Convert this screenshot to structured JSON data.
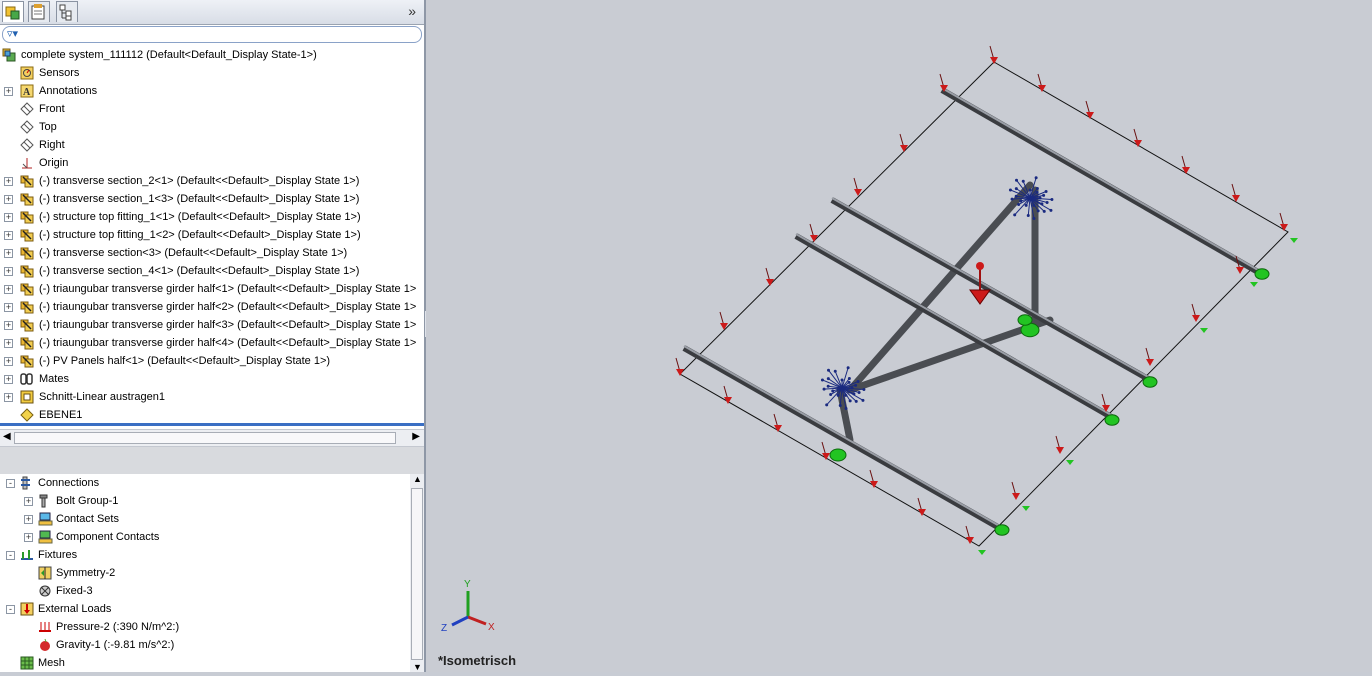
{
  "feature_tree": {
    "items": [
      {
        "label": "complete system_111112  (Default<Default_Display State-1>)",
        "icon": "assembly-icon",
        "expander": ""
      },
      {
        "label": "Sensors",
        "icon": "sensors-icon",
        "expander": ""
      },
      {
        "label": "Annotations",
        "icon": "annotations-icon",
        "expander": "+"
      },
      {
        "label": "Front",
        "icon": "plane-icon",
        "expander": ""
      },
      {
        "label": "Top",
        "icon": "plane-icon",
        "expander": ""
      },
      {
        "label": "Right",
        "icon": "plane-icon",
        "expander": ""
      },
      {
        "label": "Origin",
        "icon": "origin-icon",
        "expander": ""
      },
      {
        "label": "(-) transverse section_2<1> (Default<<Default>_Display State 1>)",
        "icon": "subassembly-icon",
        "expander": "+"
      },
      {
        "label": "(-) transverse section_1<3> (Default<<Default>_Display State 1>)",
        "icon": "subassembly-icon",
        "expander": "+"
      },
      {
        "label": "(-) structure top fitting_1<1> (Default<<Default>_Display State 1>)",
        "icon": "subassembly-icon",
        "expander": "+"
      },
      {
        "label": "(-) structure top fitting_1<2> (Default<<Default>_Display State 1>)",
        "icon": "subassembly-icon",
        "expander": "+"
      },
      {
        "label": "(-) transverse section<3> (Default<<Default>_Display State 1>)",
        "icon": "subassembly-icon",
        "expander": "+"
      },
      {
        "label": "(-) transverse section_4<1> (Default<<Default>_Display State 1>)",
        "icon": "subassembly-icon",
        "expander": "+"
      },
      {
        "label": "(-) triaungubar transverse girder half<1> (Default<<Default>_Display State 1>",
        "icon": "subassembly-icon",
        "expander": "+"
      },
      {
        "label": "(-) triaungubar transverse girder half<2> (Default<<Default>_Display State 1>",
        "icon": "subassembly-icon",
        "expander": "+"
      },
      {
        "label": "(-) triaungubar transverse girder half<3> (Default<<Default>_Display State 1>",
        "icon": "subassembly-icon",
        "expander": "+"
      },
      {
        "label": "(-) triaungubar transverse girder half<4> (Default<<Default>_Display State 1>",
        "icon": "subassembly-icon",
        "expander": "+"
      },
      {
        "label": "(-) PV Panels half<1> (Default<<Default>_Display State 1>)",
        "icon": "subassembly-icon",
        "expander": "+"
      },
      {
        "label": "Mates",
        "icon": "mates-icon",
        "expander": "+"
      },
      {
        "label": "Schnitt-Linear austragen1",
        "icon": "feature-icon",
        "expander": "+"
      },
      {
        "label": "EBENE1",
        "icon": "plane-yellow-icon",
        "expander": ""
      }
    ]
  },
  "simulation_tree": {
    "items": [
      {
        "label": "Connections",
        "icon": "connections-icon",
        "expander": "-",
        "level": 0
      },
      {
        "label": "Bolt Group-1",
        "icon": "bolt-icon",
        "expander": "+",
        "level": 1
      },
      {
        "label": "Contact Sets",
        "icon": "contact-sets-icon",
        "expander": "+",
        "level": 1
      },
      {
        "label": "Component Contacts",
        "icon": "component-contacts-icon",
        "expander": "+",
        "level": 1
      },
      {
        "label": "Fixtures",
        "icon": "fixtures-icon",
        "expander": "-",
        "level": 0
      },
      {
        "label": "Symmetry-2",
        "icon": "symmetry-icon",
        "expander": "",
        "level": 1
      },
      {
        "label": "Fixed-3",
        "icon": "fixed-icon",
        "expander": "",
        "level": 1
      },
      {
        "label": "External Loads",
        "icon": "external-loads-icon",
        "expander": "-",
        "level": 0
      },
      {
        "label": "Pressure-2 (:390 N/m^2:)",
        "icon": "pressure-icon",
        "expander": "",
        "level": 1
      },
      {
        "label": "Gravity-1 (:-9.81 m/s^2:)",
        "icon": "gravity-icon",
        "expander": "",
        "level": 1
      },
      {
        "label": "Mesh",
        "icon": "mesh-icon",
        "expander": "",
        "level": 0
      }
    ]
  },
  "viewport": {
    "view_name": "*Isometrisch",
    "triad": {
      "x": "X",
      "y": "Y",
      "z": "Z"
    }
  },
  "colors": {
    "load_arrow": "#cc1a1a",
    "fixture": "#22c422",
    "bolt": "#1a2a80",
    "beam": "#4a4d52",
    "background": "#c9ccd3"
  }
}
